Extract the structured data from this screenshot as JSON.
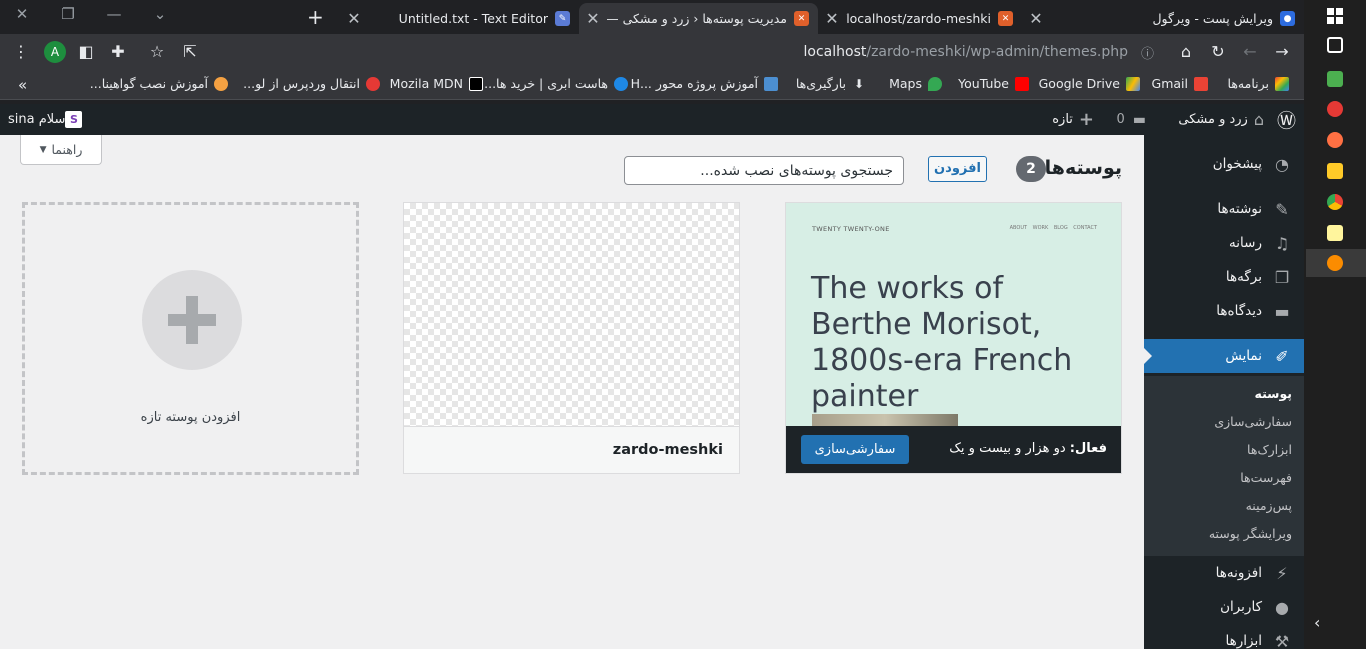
{
  "tabs": [
    {
      "title": "ویرایش پست - ویرگول",
      "active": false
    },
    {
      "title": "localhost/zardo-meshki/",
      "active": false
    },
    {
      "title": "مدیریت پوسته‌ها ‹ زرد و مشکی —",
      "active": true
    },
    {
      "title": "Untitled.txt - Text Editor",
      "active": false
    }
  ],
  "toolbar": {
    "url_host": "localhost",
    "url_path": "/zardo-meshki/wp-admin/themes.php",
    "profile_initial": "A"
  },
  "bookmarks": [
    "برنامه‌ها",
    "Gmail",
    "Google Drive",
    "YouTube",
    "Maps",
    "بارگیری‌ها",
    "آموزش پروژه محور ...H",
    "هاست ابری | خرید ها...",
    "Mozila MDN",
    "انتقال وردپرس از لو...",
    "آموزش نصب گواهینا...",
    "»"
  ],
  "adminbar": {
    "site_name": "زرد و مشکی",
    "comments_count": "0",
    "new_label": "تازه",
    "greeting": "سلام sina"
  },
  "sidebar": {
    "items": [
      "پیشخوان",
      "نوشته‌ها",
      "رسانه",
      "برگه‌ها",
      "دیدگاه‌ها",
      "نمایش",
      "افزونه‌ها",
      "کاربران",
      "ابزارها"
    ],
    "submenu": [
      "پوسته",
      "سفارشی‌سازی",
      "ابزارک‌ها",
      "فهرست‌ها",
      "پس‌زمینه",
      "ویرایشگر پوسته"
    ]
  },
  "main": {
    "help_label": "راهنما",
    "page_title": "پوسته‌ها",
    "theme_count": "2",
    "add_label": "افزودن",
    "search_placeholder": "جستجوی پوسته‌های نصب شده...",
    "active_theme": {
      "screenshot_brand": "TWENTY TWENTY-ONE",
      "screenshot_nav": "ABOUT WORK BLOG CONTACT",
      "screenshot_headline": "The works of Berthe Morisot, 1800s-era French painter",
      "active_prefix": "فعال:",
      "name": "دو هزار و بیست و یک",
      "customize_label": "سفارشی‌سازی"
    },
    "theme_2_name": "zardo-meshki",
    "add_new_label": "افزودن پوسته تازه"
  },
  "colors": {
    "wp_blue": "#2271b1",
    "admin_dark": "#1d2327",
    "chrome_dark": "#35363a"
  }
}
